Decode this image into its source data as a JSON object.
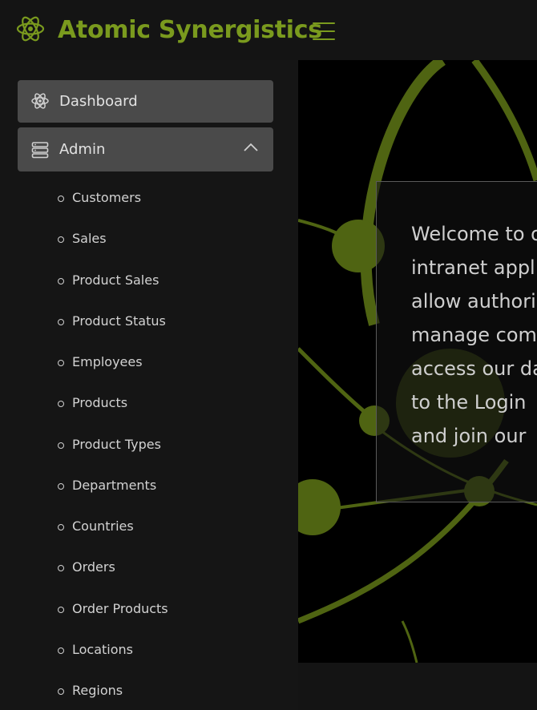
{
  "app": {
    "title": "Atomic Synergistics"
  },
  "header": {
    "menu_icon": "hamburger-icon",
    "logo_icon": "atom-icon"
  },
  "sidebar": {
    "dashboard": {
      "label": "Dashboard",
      "icon": "atom-icon"
    },
    "admin": {
      "label": "Admin",
      "icon": "server-icon",
      "expanded": true,
      "chevron_icon": "chevron-up-icon"
    },
    "items": [
      {
        "label": "Customers"
      },
      {
        "label": "Sales"
      },
      {
        "label": "Product Sales"
      },
      {
        "label": "Product Status"
      },
      {
        "label": "Employees"
      },
      {
        "label": "Products"
      },
      {
        "label": "Product Types"
      },
      {
        "label": "Departments"
      },
      {
        "label": "Countries"
      },
      {
        "label": "Orders"
      },
      {
        "label": "Order Products"
      },
      {
        "label": "Locations"
      },
      {
        "label": "Regions"
      }
    ]
  },
  "main": {
    "welcome_lines": [
      "Welcome to o",
      "intranet appl",
      "allow authori",
      "manage com",
      "access our da",
      "to the Login",
      "and join our"
    ]
  },
  "colors": {
    "accent": "#7a9a1e",
    "hero_art": "#4f6412",
    "nav_button": "#4a4a4a",
    "background": "#141414"
  }
}
